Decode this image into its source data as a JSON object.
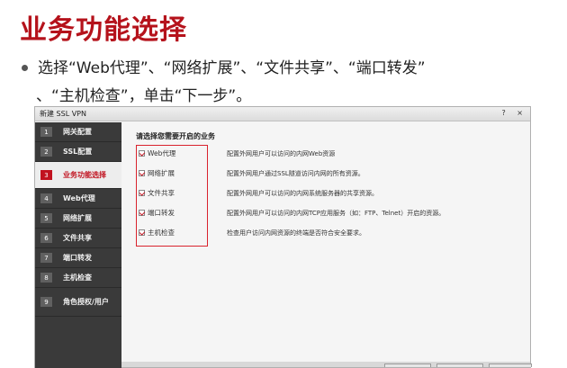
{
  "slide": {
    "title": "业务功能选择",
    "bullet_line1": "选择“Web代理”、“网络扩展”、“文件共享”、“端口转发”",
    "bullet_line2": "、“主机检查”，单击“下一步”。"
  },
  "dialog": {
    "title": "新建 SSL VPN",
    "help_label": "?",
    "close_label": "×",
    "steps": [
      {
        "num": "1",
        "label": "网关配置"
      },
      {
        "num": "2",
        "label": "SSL配置"
      },
      {
        "num": "3",
        "label": "业务功能选择"
      },
      {
        "num": "4",
        "label": "Web代理"
      },
      {
        "num": "5",
        "label": "网络扩展"
      },
      {
        "num": "6",
        "label": "文件共享"
      },
      {
        "num": "7",
        "label": "端口转发"
      },
      {
        "num": "8",
        "label": "主机检查"
      },
      {
        "num": "9",
        "label": "角色授权/用户"
      }
    ],
    "heading": "请选择您需要开启的业务",
    "options": [
      {
        "label": "Web代理",
        "checked": true,
        "desc": "配置外网用户可以访问的内网Web资源"
      },
      {
        "label": "网络扩展",
        "checked": true,
        "desc": "配置外网用户通过SSL隧道访问内网的所有资源。"
      },
      {
        "label": "文件共享",
        "checked": true,
        "desc": "配置外网用户可以访问的内网系统服务器的共享资源。"
      },
      {
        "label": "端口转发",
        "checked": true,
        "desc": "配置外网用户可以访问的内网TCP应用服务（如：FTP、Telnet）开启的资源。"
      },
      {
        "label": "主机检查",
        "checked": true,
        "desc": "检查用户访问内网资源的终端是否符合安全要求。"
      }
    ],
    "colors": {
      "accent": "#c1121f",
      "sidebar": "#3a3a3a",
      "title": "#b5121b"
    }
  }
}
